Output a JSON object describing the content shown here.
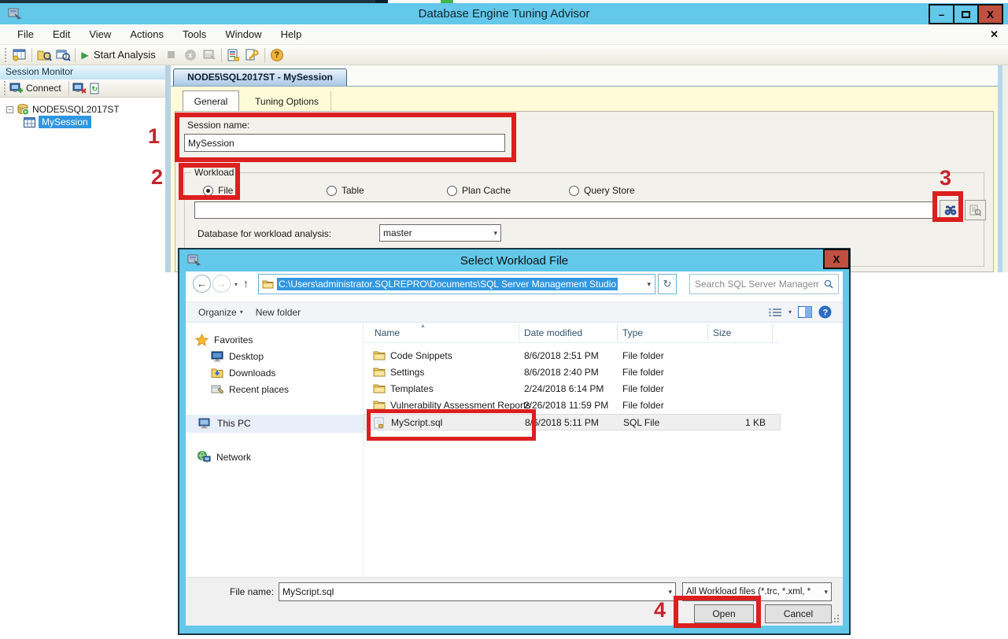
{
  "colors": {
    "titlebar_blue": "#63c8ea",
    "annotation_red": "#dc1f1f",
    "annotation_number_red": "#c3242b",
    "close_button_red": "#c0503f",
    "address_selection_blue": "#3197e1",
    "tree_selection_blue": "#2f96e0",
    "tab_page_yellow": "#fffbd8"
  },
  "icons": {
    "minimize": "–",
    "close": "X",
    "menubar_close": "✕",
    "back": "←",
    "forward": "→",
    "up": "↑",
    "dropdown": "▾",
    "refresh": "↻",
    "sort_ascending": "▲",
    "play": "▶",
    "stop": "■",
    "cancel": "x",
    "expander_collapse": "−",
    "help": "?"
  },
  "main_window": {
    "title": "Database Engine Tuning Advisor",
    "menu": {
      "items": [
        "File",
        "Edit",
        "View",
        "Actions",
        "Tools",
        "Window",
        "Help"
      ]
    },
    "toolbar": {
      "start_analysis_label": "Start Analysis"
    },
    "session_monitor": {
      "title": "Session Monitor",
      "connect_label": "Connect",
      "tree": {
        "server": "NODE5\\SQL2017ST",
        "session": "MySession"
      }
    },
    "document_tab": "NODE5\\SQL2017ST - MySession",
    "tabs": {
      "general": "General",
      "tuning": "Tuning Options"
    },
    "general_tab": {
      "session_name_label": "Session name:",
      "session_name_value": "MySession",
      "workload_group_label": "Workload",
      "radios": [
        "File",
        "Table",
        "Plan Cache",
        "Query Store"
      ],
      "selected_radio": "File",
      "workload_file_value": "",
      "database_label": "Database for workload analysis:",
      "database_value": "master"
    }
  },
  "dialog": {
    "title": "Select Workload File",
    "address_path": "C:\\Users\\administrator.SQLREPRO\\Documents\\SQL Server Management Studio",
    "search_placeholder": "Search SQL Server Manageme...",
    "command_bar": {
      "organize": "Organize",
      "new_folder": "New folder"
    },
    "sidebar": {
      "items": [
        "Favorites",
        "Desktop",
        "Downloads",
        "Recent places",
        "This PC",
        "Network"
      ]
    },
    "columns": [
      "Name",
      "Date modified",
      "Type",
      "Size"
    ],
    "files": [
      {
        "name": "Code Snippets",
        "date": "8/6/2018 2:51 PM",
        "type": "File folder",
        "size": ""
      },
      {
        "name": "Settings",
        "date": "8/6/2018 2:40 PM",
        "type": "File folder",
        "size": ""
      },
      {
        "name": "Templates",
        "date": "2/24/2018 6:14 PM",
        "type": "File folder",
        "size": ""
      },
      {
        "name": "Vulnerability Assessment Reports",
        "date": "2/26/2018 11:59 PM",
        "type": "File folder",
        "size": ""
      },
      {
        "name": "MyScript.sql",
        "date": "8/6/2018 5:11 PM",
        "type": "SQL File",
        "size": "1 KB"
      }
    ],
    "footer": {
      "file_name_label": "File name:",
      "file_name_value": "MyScript.sql",
      "file_type_value": "All Workload files (*.trc, *.xml, *",
      "open_label": "Open",
      "cancel_label": "Cancel"
    }
  },
  "annotations": {
    "n1": "1",
    "n2": "2",
    "n3": "3",
    "n4": "4"
  }
}
